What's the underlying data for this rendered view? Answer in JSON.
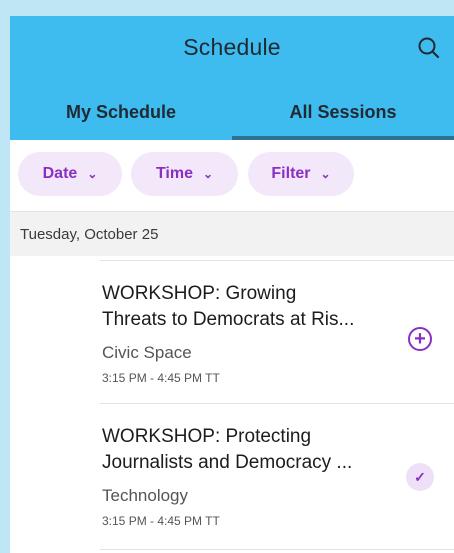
{
  "header": {
    "title": "Schedule",
    "search_icon": "search-icon",
    "tabs": [
      {
        "label": "My Schedule",
        "active": false
      },
      {
        "label": "All Sessions",
        "active": true
      }
    ]
  },
  "filters": [
    {
      "label": "Date",
      "icon": "chevron-down-icon"
    },
    {
      "label": "Time",
      "icon": "chevron-down-icon"
    },
    {
      "label": "Filter",
      "icon": "chevron-down-icon"
    }
  ],
  "day_header": "Tuesday, October 25",
  "sessions": [
    {
      "title_line1": "WORKSHOP: Growing",
      "title_line2": "Threats to Democrats at Ris...",
      "track": "Civic Space",
      "time": "3:15 PM - 4:45 PM TT",
      "action_icon": "add-circle-icon",
      "added": false
    },
    {
      "title_line1": "WORKSHOP: Protecting",
      "title_line2": "Journalists and Democracy ...",
      "track": "Technology",
      "time": "3:15 PM - 4:45 PM TT",
      "action_icon": "check-icon",
      "added": true
    }
  ],
  "colors": {
    "header_bg": "#3fbcef",
    "tab_indicator": "#2e6f94",
    "accent": "#8a2fc2",
    "chip_bg": "#f3e7fa",
    "page_bg": "#bfe6f5"
  }
}
